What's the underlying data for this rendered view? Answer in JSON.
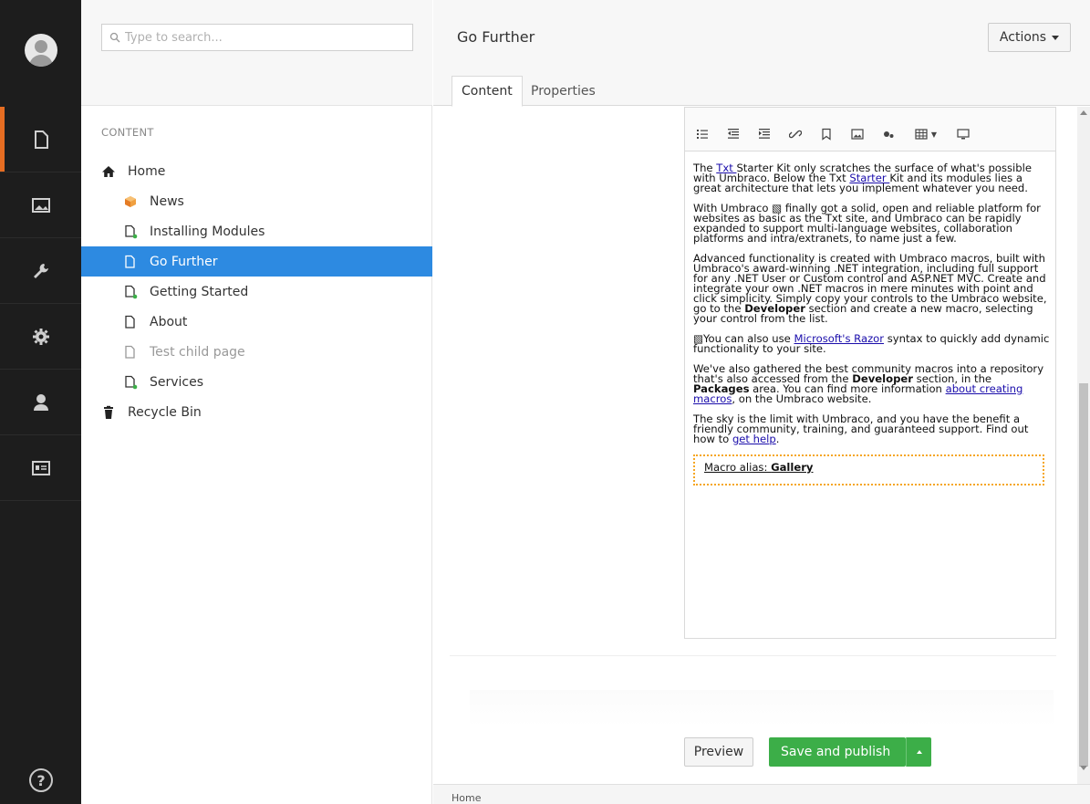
{
  "sections": {
    "items": [
      {
        "name": "content"
      },
      {
        "name": "media"
      },
      {
        "name": "settings"
      },
      {
        "name": "developer"
      },
      {
        "name": "users"
      },
      {
        "name": "members"
      }
    ],
    "help_glyph": "?"
  },
  "search": {
    "placeholder": "Type to search..."
  },
  "tree": {
    "heading": "CONTENT",
    "nodes": [
      {
        "label": "Home",
        "icon": "home-icon"
      },
      {
        "label": "News",
        "icon": "news-cube-icon"
      },
      {
        "label": "Installing Modules",
        "icon": "doc-child-icon"
      },
      {
        "label": "Go Further",
        "icon": "doc-icon"
      },
      {
        "label": "Getting Started",
        "icon": "doc-child-icon"
      },
      {
        "label": "About",
        "icon": "doc-icon"
      },
      {
        "label": "Test child page",
        "icon": "doc-icon"
      },
      {
        "label": "Services",
        "icon": "doc-child-icon"
      },
      {
        "label": "Recycle Bin",
        "icon": "trash-icon"
      }
    ],
    "selected_index": 3
  },
  "editor": {
    "page_name": "Go Further",
    "actions_label": "Actions",
    "tabs": [
      {
        "label": "Content"
      },
      {
        "label": "Properties"
      }
    ],
    "rte": {
      "p1_a": "The ",
      "p1_link1": "Txt ",
      "p1_b": "Starter Kit only scratches the surface of what's possible with Umbraco. Below the Txt ",
      "p1_link2": "Starter ",
      "p1_c": "Kit and its modules lies a great architecture that lets you implement whatever you need.",
      "p2_a": "With Umbraco ",
      "p2_b": " finally got a solid, open and reliable platform for websites as basic as the Txt site, and Umbraco can be rapidly expanded to support multi-language websites, collaboration platforms and intra/extranets, to name just a few.",
      "p3_a": "Advanced functionality is created with Umbraco macros, built with Umbraco's award-winning .NET integration, including full support for any .NET User or Custom control and ASP.NET MVC. Create and integrate your own .NET macros in mere minutes with point and click simplicity. Simply copy your controls to the Umbraco website, go to the ",
      "p3_bold": "Developer",
      "p3_b": " section and create a new macro, selecting your control from the list.",
      "p4_a": "You can also use ",
      "p4_link": "Microsoft's Razor",
      "p4_b": " syntax to quickly add dynamic functionality to your site.",
      "p5_a": "We've also gathered the best community macros into a repository that's also accessed from the ",
      "p5_bold1": "Developer",
      "p5_b": " section, in the ",
      "p5_bold2": "Packages",
      "p5_c": " area. You can find more information ",
      "p5_link": "about creating macros",
      "p5_d": ", on the Umbraco website.",
      "p6_a": "The sky is the limit with Umbraco, and you have the benefit a friendly community, training, and guaranteed support. Find out how to ",
      "p6_link": "get help",
      "p6_b": ".",
      "macro_label": "Macro alias: ",
      "macro_alias": "Gallery"
    },
    "preview_label": "Preview",
    "publish_label": "Save and publish",
    "breadcrumb": "Home"
  },
  "colors": {
    "sidebar_bg": "#1d1d1d",
    "active_accent": "#e66d22",
    "selected_node": "#2d8ae1",
    "publish_green": "#3cae48",
    "macro_border": "#f5a623"
  }
}
